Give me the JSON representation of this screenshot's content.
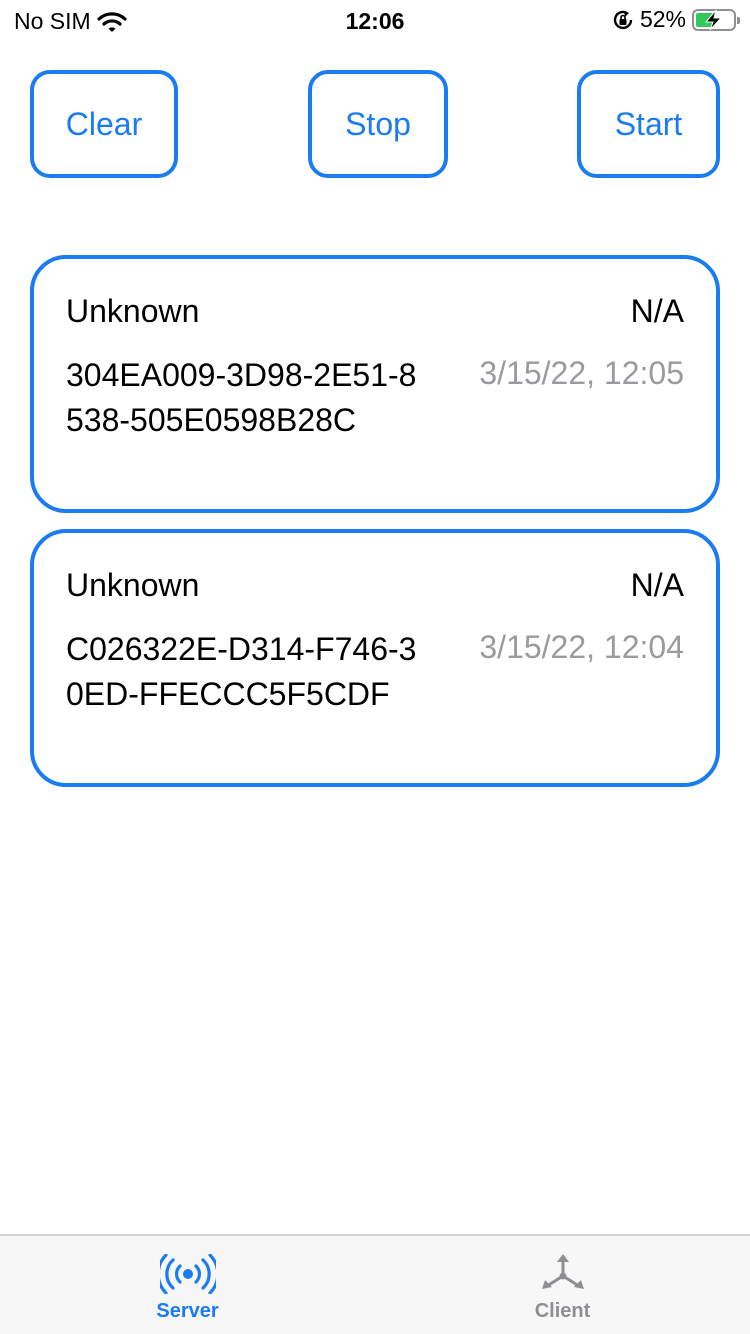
{
  "status_bar": {
    "carrier": "No SIM",
    "time": "12:06",
    "battery_percent": "52%",
    "battery_level": 0.52,
    "icons": [
      "wifi-icon",
      "rotation-lock-icon",
      "battery-charging-icon"
    ]
  },
  "toolbar": {
    "clear_label": "Clear",
    "stop_label": "Stop",
    "start_label": "Start"
  },
  "devices": [
    {
      "name": "Unknown",
      "rssi": "N/A",
      "uuid": "304EA009-3D98-2E51-8538-505E0598B28C",
      "date": "3/15/22, 12:05"
    },
    {
      "name": "Unknown",
      "rssi": "N/A",
      "uuid": "C026322E-D314-F746-30ED-FFECCC5F5CDF",
      "date": "3/15/22, 12:04"
    }
  ],
  "tab_bar": {
    "tabs": [
      {
        "label": "Server",
        "icon": "broadcast-icon",
        "selected": true
      },
      {
        "label": "Client",
        "icon": "network-nodes-icon",
        "selected": false
      }
    ]
  },
  "colors": {
    "accent": "#1a7cf0",
    "secondary_text": "#9a9a9f",
    "battery": "#34c759"
  }
}
